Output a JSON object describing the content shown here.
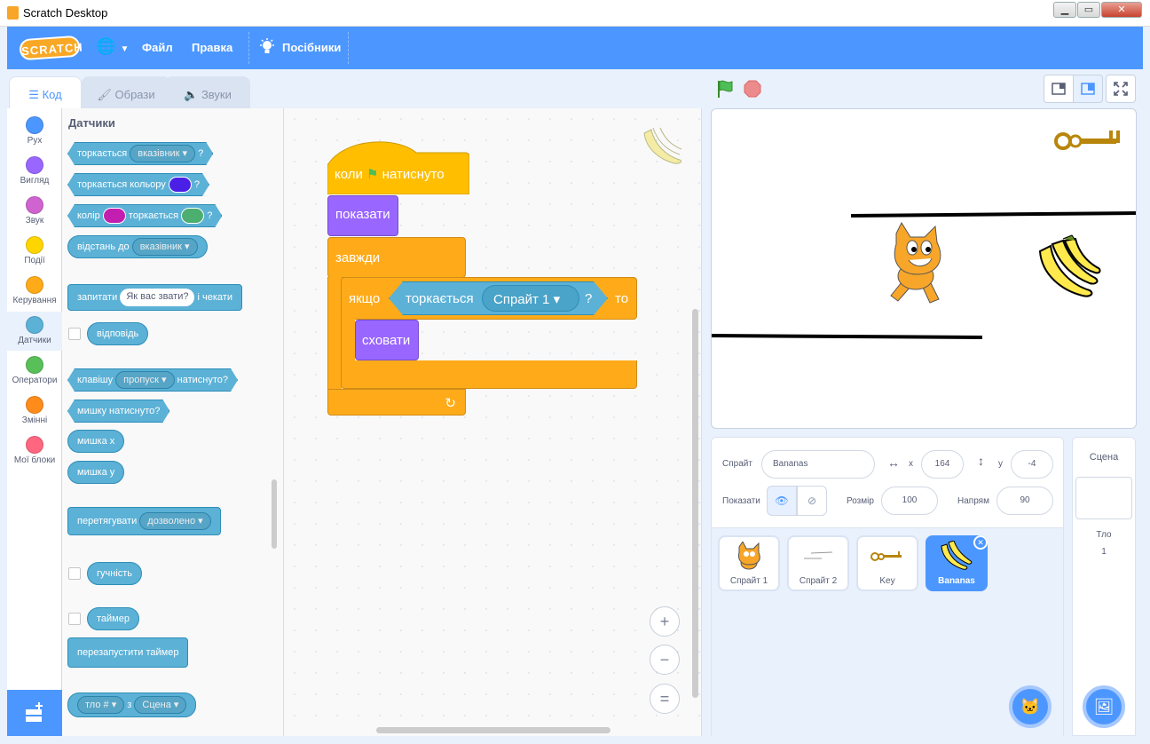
{
  "window": {
    "title": "Scratch Desktop"
  },
  "menu": {
    "logo": "SCRATCH",
    "globe": "🌐",
    "file": "Файл",
    "edit": "Правка",
    "tutorials": "Посібники"
  },
  "tabs": [
    {
      "label": "Код"
    },
    {
      "label": "Образи"
    },
    {
      "label": "Звуки"
    }
  ],
  "categories": [
    {
      "label": "Рух",
      "color": "#4c97ff"
    },
    {
      "label": "Вигляд",
      "color": "#9966ff"
    },
    {
      "label": "Звук",
      "color": "#cf63cf"
    },
    {
      "label": "Події",
      "color": "#ffd500"
    },
    {
      "label": "Керування",
      "color": "#ffab19"
    },
    {
      "label": "Датчики",
      "color": "#5cb1d6"
    },
    {
      "label": "Оператори",
      "color": "#59c059"
    },
    {
      "label": "Змінні",
      "color": "#ff8c1a"
    },
    {
      "label": "Мої блоки",
      "color": "#ff6680"
    }
  ],
  "palette": {
    "heading": "Датчики",
    "touching": "торкається",
    "touching_arg": "вказівник",
    "q": "?",
    "touching_color": "торкається кольору",
    "color_word": "колір",
    "color_touching": "торкається",
    "distance": "відстань до",
    "distance_arg": "вказівник",
    "ask": "запитати",
    "ask_arg": "Як вас звати?",
    "ask_wait": "і чекати",
    "answer": "відповідь",
    "key": "клавішу",
    "key_arg": "пропуск",
    "key_pressed": "натиснуто?",
    "mouse_down": "мишку натиснуто?",
    "mouse_x": "мишка х",
    "mouse_y": "мишка у",
    "drag": "перетягувати",
    "drag_arg": "дозволено",
    "loudness": "гучність",
    "timer": "таймер",
    "reset_timer": "перезапустити таймер",
    "backdrop": "тло #",
    "of": "з",
    "of_arg": "Сцена",
    "swatch1": "#4a1fe6",
    "swatch2": "#c21fb0",
    "swatch3": "#4caf70"
  },
  "script": {
    "when": "коли",
    "clicked": "натиснуто",
    "show": "показати",
    "forever": "завжди",
    "if": "якщо",
    "touching": "торкається",
    "sprite_arg": "Спрайт 1",
    "q": "?",
    "then": "то",
    "hide": "сховати",
    "zoom_in": "+",
    "zoom_out": "−",
    "zoom_reset": "="
  },
  "sprite_info": {
    "sprite_label": "Спрайт",
    "name": "Bananas",
    "x_label": "x",
    "x": "164",
    "y_label": "y",
    "y": "-4",
    "show_label": "Показати",
    "size_label": "Розмір",
    "size": "100",
    "direction_label": "Напрям",
    "direction": "90"
  },
  "sprites": [
    {
      "name": "Спрайт 1"
    },
    {
      "name": "Спрайт 2"
    },
    {
      "name": "Key"
    },
    {
      "name": "Bananas"
    }
  ],
  "scene": {
    "title": "Сцена",
    "backdrop_label": "Тло",
    "backdrop_count": "1"
  }
}
